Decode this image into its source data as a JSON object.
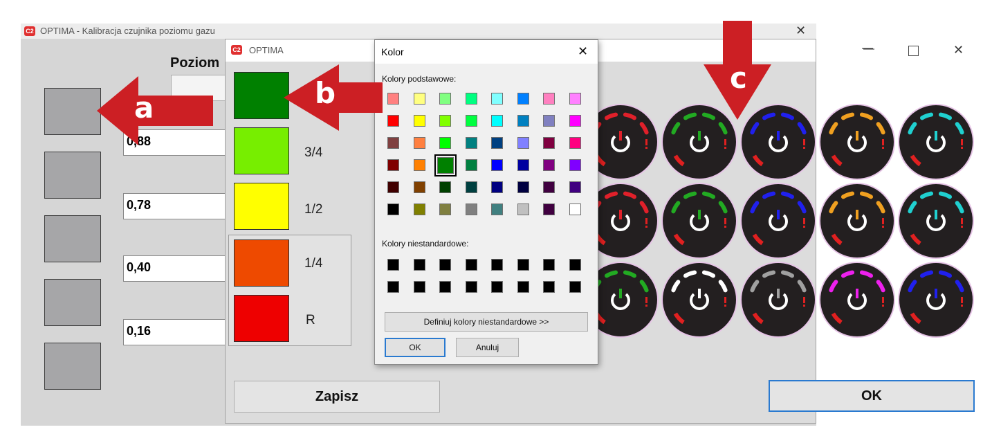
{
  "main_window": {
    "title": "OPTIMA - Kalibracja czujnika poziomu gazu",
    "level_heading": "Poziom",
    "values": [
      "0,88",
      "0,78",
      "0,40",
      "0,16"
    ],
    "ok_label": "OK"
  },
  "optima_dialog": {
    "title": "OPTIMA",
    "color_rows": [
      {
        "label": "",
        "color": "#008000"
      },
      {
        "label": "3/4",
        "color": "#77ee00"
      },
      {
        "label": "1/2",
        "color": "#ffff00"
      },
      {
        "label": "1/4",
        "color": "#ee4a00"
      },
      {
        "label": "R",
        "color": "#ee0000"
      }
    ],
    "save_label": "Zapisz"
  },
  "kolor_dialog": {
    "title": "Kolor",
    "basic_colors_label": "Kolory podstawowe:",
    "custom_colors_label": "Kolory niestandardowe:",
    "define_custom_label": "Definiuj kolory niestandardowe >>",
    "ok_label": "OK",
    "cancel_label": "Anuluj",
    "selected_color": "#008000",
    "basic_colors": [
      [
        "#ff8080",
        "#ffff80",
        "#80ff80",
        "#00ff80",
        "#80ffff",
        "#0080ff",
        "#ff80c0",
        "#ff80ff"
      ],
      [
        "#ff0000",
        "#ffff00",
        "#80ff00",
        "#00ff40",
        "#00ffff",
        "#0080c0",
        "#8080c0",
        "#ff00ff"
      ],
      [
        "#804040",
        "#ff8040",
        "#00ff00",
        "#008080",
        "#004080",
        "#8080ff",
        "#800040",
        "#ff0080"
      ],
      [
        "#800000",
        "#ff8000",
        "#008000",
        "#008040",
        "#0000ff",
        "#0000a0",
        "#800080",
        "#8000ff"
      ],
      [
        "#400000",
        "#804000",
        "#004000",
        "#004040",
        "#000080",
        "#000040",
        "#400040",
        "#400080"
      ],
      [
        "#000000",
        "#808000",
        "#808040",
        "#808080",
        "#408080",
        "#c0c0c0",
        "#400040",
        "#ffffff"
      ]
    ],
    "custom_colors": [
      [
        "#000000",
        "#000000",
        "#000000",
        "#000000",
        "#000000",
        "#000000",
        "#000000",
        "#000000"
      ],
      [
        "#000000",
        "#000000",
        "#000000",
        "#000000",
        "#000000",
        "#000000",
        "#000000",
        "#000000"
      ]
    ]
  },
  "annotations": [
    {
      "label": "a",
      "color": "#cc1f24"
    },
    {
      "label": "b",
      "color": "#cc1f24"
    },
    {
      "label": "c",
      "color": "#cc1f24"
    }
  ],
  "gauge_icons": {
    "rows": [
      [
        "#e0202a",
        "#22aa22",
        "#2020ee",
        "#f0a020",
        "#20d0d0"
      ],
      [
        "#e0202a",
        "#22aa22",
        "#2020ee",
        "#f0a020",
        "#20d0d0"
      ],
      [
        "#22aa22",
        "#ffffff",
        "#a0a0a0",
        "#ee20ee",
        "#2020ee"
      ]
    ],
    "icon": "power-icon",
    "alert_icon": "exclamation-icon"
  }
}
